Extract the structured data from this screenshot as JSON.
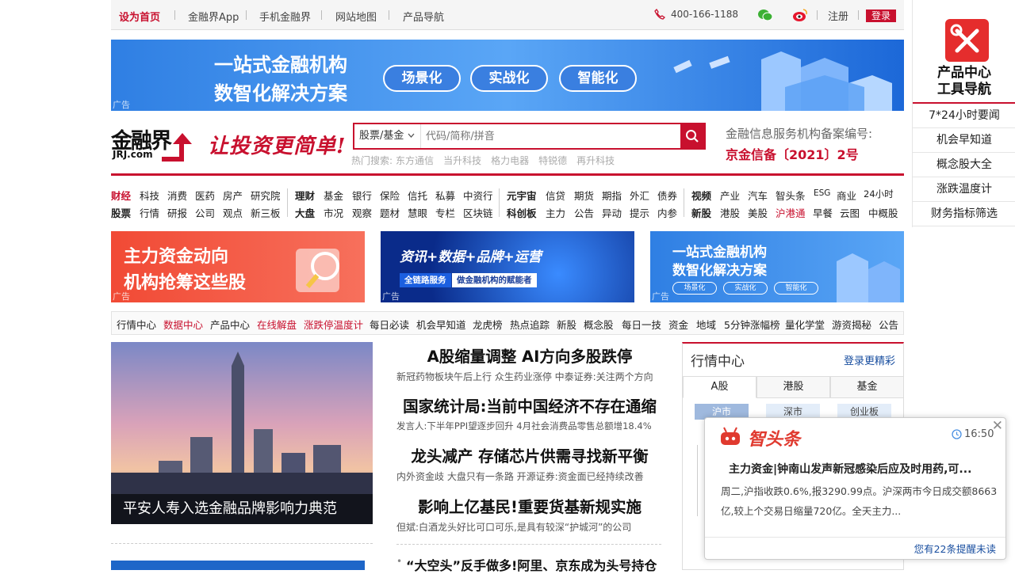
{
  "topbar": {
    "home": "设为首页",
    "app": "金融界App",
    "mobile": "手机金融界",
    "sitemap": "网站地图",
    "products": "产品导航",
    "phone": "400-166-1188",
    "register": "注册",
    "login": "登录"
  },
  "banner": {
    "line1": "一站式金融机构",
    "line2": "数智化解决方案",
    "pills": [
      "场景化",
      "实战化",
      "智能化"
    ],
    "ad": "广告"
  },
  "logo": {
    "name": "金融界",
    "domain": "JRJ.com",
    "slogan": "让投资更简单!"
  },
  "search": {
    "type": "股票/基金",
    "placeholder": "代码/简称/拼音",
    "hot_label": "热门搜索:",
    "hot": [
      "东方通信",
      "当升科技",
      "格力电器",
      "特锐德",
      "再升科技"
    ]
  },
  "record": {
    "label": "金融信息服务机构备案编号:",
    "number": "京金信备〔2021〕2号"
  },
  "nav": {
    "g1": {
      "r1": [
        "财经",
        "科技",
        "消费",
        "医药",
        "房产",
        "研究院"
      ],
      "r2": [
        "股票",
        "行情",
        "研报",
        "公司",
        "观点",
        "新三板"
      ]
    },
    "g2": {
      "r1": [
        "理财",
        "基金",
        "银行",
        "保险",
        "信托",
        "私募",
        "中资行"
      ],
      "r2": [
        "大盘",
        "市况",
        "观察",
        "题材",
        "慧眼",
        "专栏",
        "区块链"
      ]
    },
    "g3": {
      "r1": [
        "元宇宙",
        "信贷",
        "期货",
        "期指",
        "外汇",
        "债券"
      ],
      "r2": [
        "科创板",
        "主力",
        "公告",
        "异动",
        "提示",
        "内参"
      ]
    },
    "g4": {
      "r1": [
        "视频",
        "产业",
        "汽车",
        "智头条",
        "ESG",
        "商业",
        "24小时"
      ],
      "r2": [
        "新股",
        "港股",
        "美股",
        "沪港通",
        "早餐",
        "云图",
        "中概股"
      ]
    }
  },
  "ads": [
    {
      "l1": "主力资金动向",
      "l2": "机构抢筹这些股",
      "tag": "广告"
    },
    {
      "l1": "资讯+数据+品牌+运营",
      "l2": "全链路服务",
      "l3": "做金融机构的赋能者",
      "tag": "广告"
    },
    {
      "l1": "一站式金融机构",
      "l2": "数智化解决方案",
      "pills": [
        "场景化",
        "实战化",
        "智能化"
      ],
      "tag": "广告"
    }
  ],
  "quick": [
    "行情中心",
    "数据中心",
    "产品中心",
    "在线解盘",
    "涨跌停温度计",
    "每日必读",
    "机会早知道",
    "龙虎榜",
    "热点追踪",
    "新股",
    "概念股",
    "每日一技",
    "资金",
    "地域",
    "5分钟涨幅榜",
    "量化学堂",
    "游资揭秘",
    "公告"
  ],
  "feature": {
    "caption": "平安人寿入选金融品牌影响力典范"
  },
  "headlines": [
    {
      "title": "A股缩量调整 AI方向多股跌停",
      "sub": "新冠药物板块午后上行  众生药业涨停  中泰证券:关注两个方向"
    },
    {
      "title": "国家统计局:当前中国经济不存在通缩",
      "sub": "发言人:下半年PPI望逐步回升  4月社会消费品零售总额增18.4%"
    },
    {
      "title": "龙头减产 存储芯片供需寻找新平衡",
      "sub": "内外资金歧  大盘只有一条路  开源证券:资金面已经持续改善"
    },
    {
      "title": "影响上亿基民!重要货基新规实施",
      "sub": "但斌:白酒龙头好比可口可乐,是具有较深“护城河”的公司"
    },
    {
      "title": "“大空头”反手做多!阿里、京东成为头号持仓",
      "sub": ""
    }
  ],
  "market": {
    "title": "行情中心",
    "more": "登录更精彩",
    "tabs": [
      "A股",
      "港股",
      "基金"
    ],
    "subtabs": [
      "沪市",
      "深市",
      "创业板"
    ]
  },
  "side": {
    "title1": "产品中心",
    "title2": "工具导航",
    "items": [
      "7*24小时要闻",
      "机会早知道",
      "概念股大全",
      "涨跌温度计",
      "财务指标筛选"
    ]
  },
  "popup": {
    "brand": "智头条",
    "time": "16:50",
    "title": "主力资金|钟南山发声新冠感染后应及时用药,可...",
    "body": "周二,沪指收跌0.6%,报3290.99点。沪深两市今日成交额8663亿,较上个交易日缩量720亿。全天主力...",
    "footer": "您有22条提醒未读"
  },
  "colors": {
    "brand_red": "#c8102e",
    "link_blue": "#1a4fa0"
  }
}
